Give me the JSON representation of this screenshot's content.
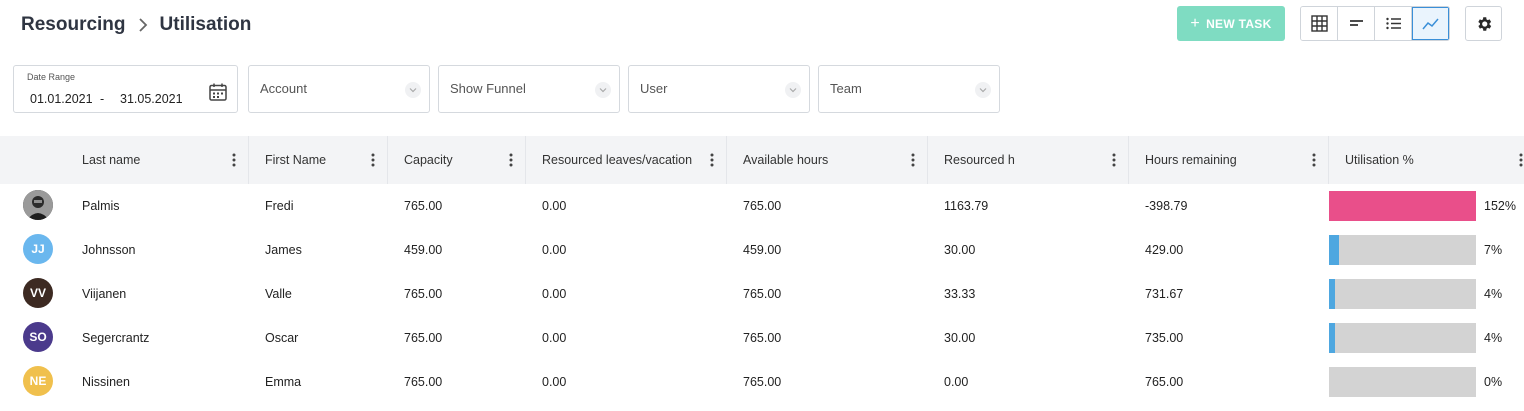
{
  "breadcrumb": {
    "section": "Resourcing",
    "page": "Utilisation"
  },
  "toolbar": {
    "new_task_label": "NEW TASK",
    "icons": [
      "grid-view-icon",
      "timeline-view-icon",
      "list-view-icon",
      "chart-view-icon",
      "gear-icon"
    ],
    "active_view": "chart-view"
  },
  "filters": {
    "date_range": {
      "label": "Date Range",
      "from": "01.01.2021",
      "separator": "-",
      "to": "31.05.2021"
    },
    "account": {
      "placeholder": "Account"
    },
    "funnel": {
      "placeholder": "Show Funnel"
    },
    "user": {
      "placeholder": "User"
    },
    "team": {
      "placeholder": "Team"
    }
  },
  "table": {
    "columns": [
      "Last name",
      "First Name",
      "Capacity",
      "Resourced leaves/vacation",
      "Available hours",
      "Resourced h",
      "Hours remaining",
      "Utilisation %"
    ],
    "rows": [
      {
        "initials": "",
        "avatar_color": "#3a3a3a",
        "last": "Palmis",
        "first": "Fredi",
        "capacity": "765.00",
        "leaves": "0.00",
        "available": "765.00",
        "resourced": "1163.79",
        "remaining": "-398.79",
        "util_pct": "152%",
        "util_value": 152,
        "bar_color": "#e94f8a"
      },
      {
        "initials": "JJ",
        "avatar_color": "#6ab7ee",
        "last": "Johnsson",
        "first": "James",
        "capacity": "459.00",
        "leaves": "0.00",
        "available": "459.00",
        "resourced": "30.00",
        "remaining": "429.00",
        "util_pct": "7%",
        "util_value": 7,
        "bar_color": "#4ea7e0"
      },
      {
        "initials": "VV",
        "avatar_color": "#3d2a22",
        "last": "Viijanen",
        "first": "Valle",
        "capacity": "765.00",
        "leaves": "0.00",
        "available": "765.00",
        "resourced": "33.33",
        "remaining": "731.67",
        "util_pct": "4%",
        "util_value": 4,
        "bar_color": "#4ea7e0"
      },
      {
        "initials": "SO",
        "avatar_color": "#4b3a8c",
        "last": "Segercrantz",
        "first": "Oscar",
        "capacity": "765.00",
        "leaves": "0.00",
        "available": "765.00",
        "resourced": "30.00",
        "remaining": "735.00",
        "util_pct": "4%",
        "util_value": 4,
        "bar_color": "#4ea7e0"
      },
      {
        "initials": "NE",
        "avatar_color": "#f0c04d",
        "last": "Nissinen",
        "first": "Emma",
        "capacity": "765.00",
        "leaves": "0.00",
        "available": "765.00",
        "resourced": "0.00",
        "remaining": "765.00",
        "util_pct": "0%",
        "util_value": 0,
        "bar_color": "#4ea7e0"
      }
    ]
  }
}
